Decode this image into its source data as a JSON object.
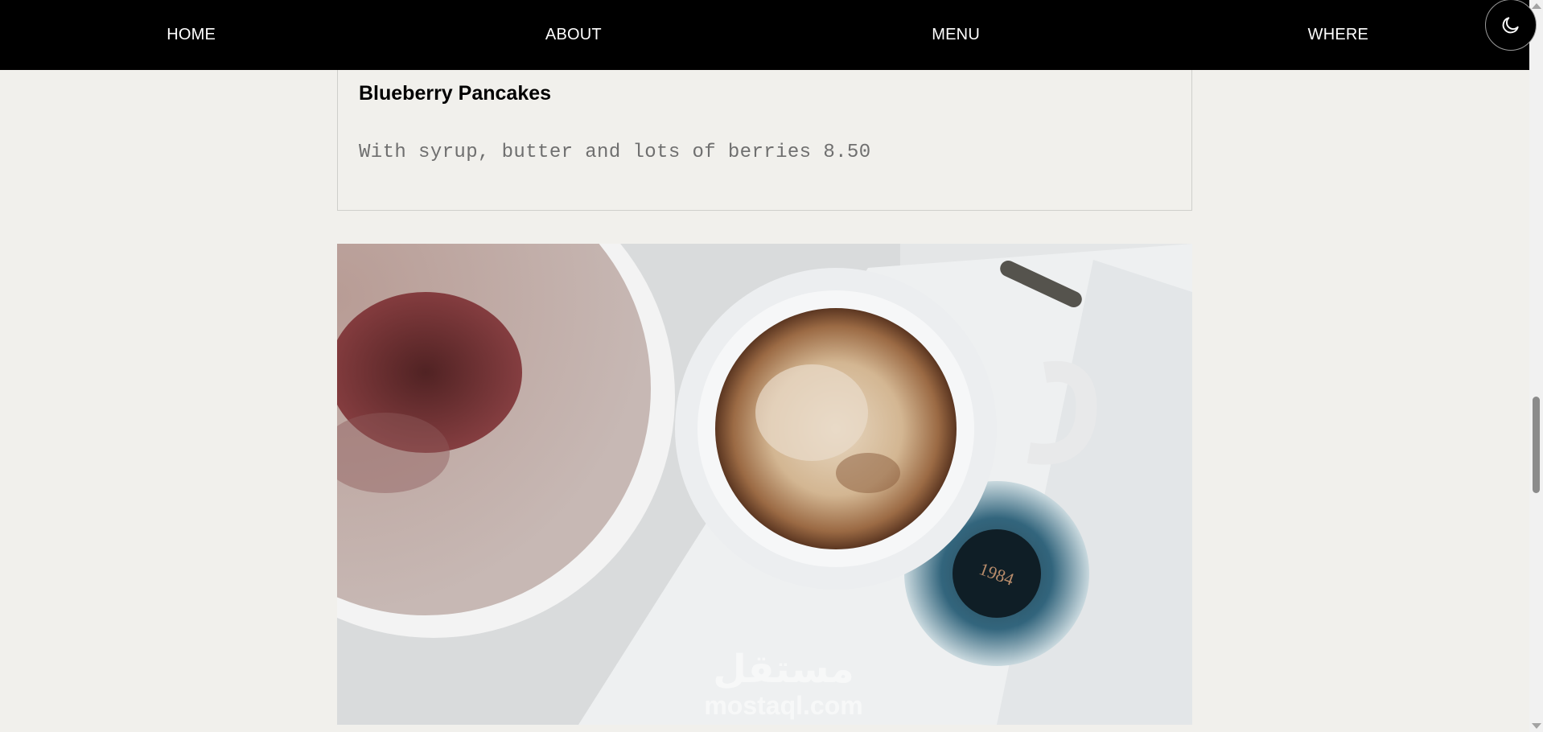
{
  "nav": {
    "items": [
      "HOME",
      "ABOUT",
      "MENU",
      "WHERE"
    ],
    "theme_toggle_icon": "moon-icon"
  },
  "menu_item": {
    "name": "Blueberry Pancakes",
    "description": "With syrup, butter and lots of berries",
    "price": "8.50"
  },
  "photo": {
    "icon": "coffee-photo",
    "book_label": "1984",
    "watermark_arabic": "مستقل",
    "watermark_latin": "mostaql.com"
  },
  "colors": {
    "nav_bg": "#000000",
    "page_bg": "#f1f0ec",
    "description_text": "#6f6f6f"
  }
}
